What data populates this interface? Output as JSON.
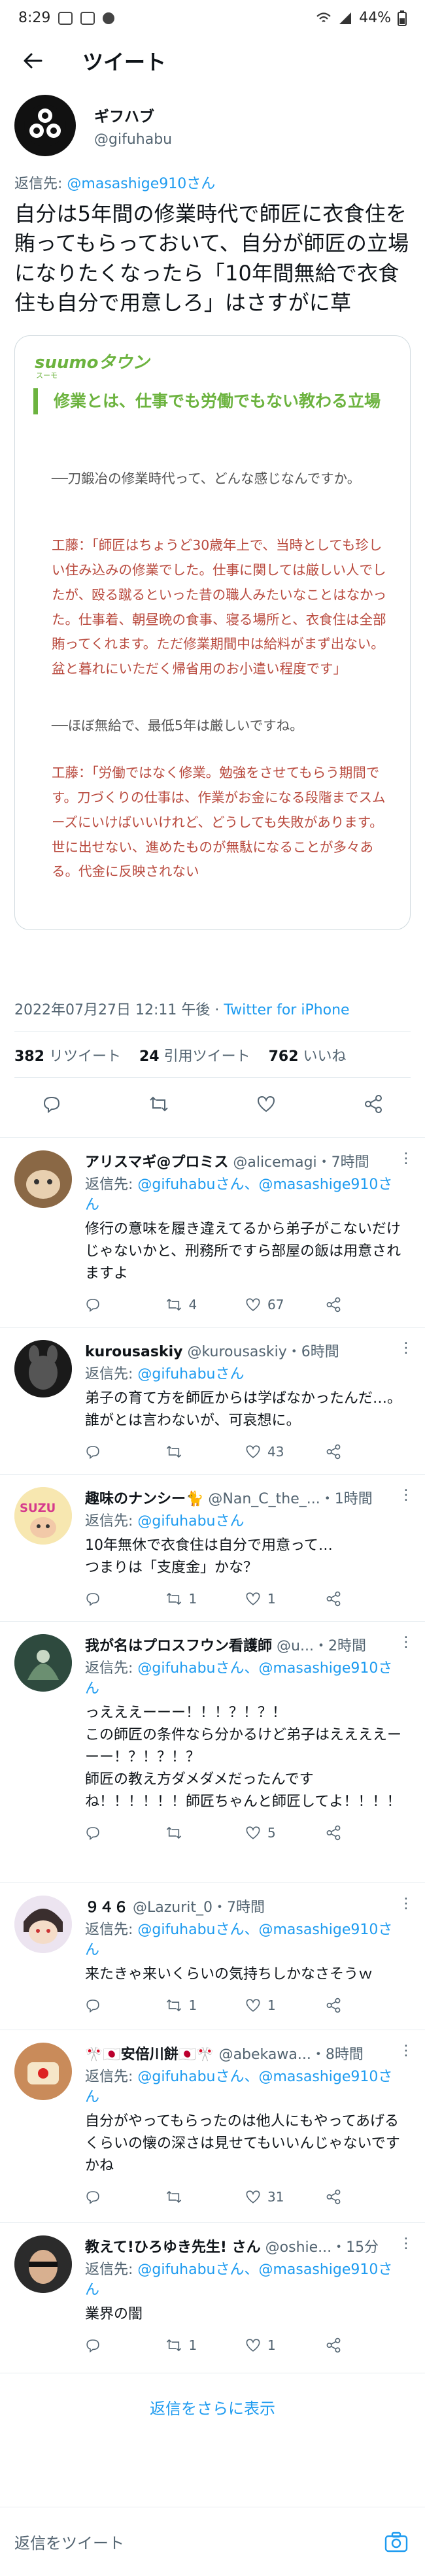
{
  "status_bar": {
    "time": "8:29",
    "battery": "44%"
  },
  "header": {
    "title": "ツイート"
  },
  "tweet": {
    "author_name": "ギフハブ",
    "author_handle": "@gifuhabu",
    "reply_prefix": "返信先: ",
    "reply_to": "@masashige910さん",
    "text": "自分は5年間の修業時代で師匠に衣食住を賄ってもらっておいて、自分が師匠の立場になりたくなったら「10年間無給で衣食住も自分で用意しろ」はさすがに草",
    "timestamp": "2022年07月27日 12:11 午後",
    "source": "Twitter for iPhone",
    "retweets_count": "382",
    "retweets_label": "リツイート",
    "quotes_count": "24",
    "quotes_label": "引用ツイート",
    "likes_count": "762",
    "likes_label": "いいね"
  },
  "quote_card": {
    "logo": "suumoタウン",
    "logo_sub": "スーモ",
    "heading": "修業とは、仕事でも労働でもない教わる立場",
    "q1": "──刀鍛冶の修業時代って、どんな感じなんですか。",
    "a1": "工藤：「師匠はちょうど30歳年上で、当時としても珍しい住み込みの修業でした。仕事に関しては厳しい人でしたが、殴る蹴るといった昔の職人みたいなことはなかった。仕事着、朝昼晩の食事、寝る場所と、衣食住は全部賄ってくれます。ただ修業期間中は給料がまず出ない。盆と暮れにいただく帰省用のお小遣い程度です」",
    "q2": "──ほぼ無給で、最低5年は厳しいですね。",
    "a2": "工藤：「労働ではなく修業。勉強をさせてもらう期間です。刀づくりの仕事は、作業がお金になる段階までスムーズにいけばいいけれど、どうしても失敗があります。世に出せない、進めたものが無駄になることが多々ある。代金に反映されない"
  },
  "replies": [
    {
      "name": "アリスマギ@プロミス",
      "handle": "@alicemagi",
      "time": "・7時間",
      "reply_to": "@gifuhabuさん、@masashige910さん",
      "text": "修行の意味を履き違えてるから弟子がこないだけじゃないかと、刑務所ですら部屋の飯は用意されますよ",
      "rt": "4",
      "likes": "67",
      "reply_count": ""
    },
    {
      "name": "kurousaskiy",
      "handle": "@kurousaskiy",
      "time": "・6時間",
      "reply_to": "@gifuhabuさん",
      "text": "弟子の育て方を師匠からは学ばなかったんだ…。誰がとは言わないが、可哀想に。",
      "rt": "",
      "likes": "43",
      "reply_count": ""
    },
    {
      "name": "趣味のナンシー🐈",
      "handle": "@Nan_C_the_...",
      "time": "・1時間",
      "reply_to": "@gifuhabuさん",
      "text": "10年無休で衣食住は自分で用意って…\nつまりは「支度金」かな？",
      "rt": "1",
      "likes": "1",
      "reply_count": ""
    },
    {
      "name": "我が名はプロスフウン看護師",
      "handle": "@u...",
      "time": "・2時間",
      "reply_to": "@gifuhabuさん、@masashige910さん",
      "text": "っえええーーー！！！？！？！\nこの師匠の条件なら分かるけど弟子はええええーーー！？！？！？\n師匠の教え方ダメダメだったんですね！！！！！！師匠ちゃんと師匠してよ！！！！",
      "rt": "",
      "likes": "5",
      "reply_count": ""
    },
    {
      "name": "９４６",
      "handle": "@Lazurit_0",
      "time": "・7時間",
      "reply_to": "@gifuhabuさん、@masashige910さん",
      "text": "来たきゃ来いくらいの気持ちしかなさそうｗ",
      "rt": "1",
      "likes": "1",
      "reply_count": ""
    },
    {
      "name": "🎌🇯🇵安倍川餅🇯🇵🎌",
      "handle": "@abekawa...",
      "time": "・8時間",
      "reply_to": "@gifuhabuさん、@masashige910さん",
      "text": "自分がやってもらったのは他人にもやってあげるくらいの懐の深さは見せてもいいんじゃないですかね",
      "rt": "",
      "likes": "31",
      "reply_count": ""
    },
    {
      "name": "教えて!ひろゆき先生! さん",
      "handle": "@oshie...",
      "time": "・15分",
      "reply_to": "@gifuhabuさん、@masashige910さん",
      "text": "業界の闇",
      "rt": "1",
      "likes": "1",
      "reply_count": ""
    }
  ],
  "more_replies": "返信をさらに表示",
  "compose_placeholder": "返信をツイート"
}
